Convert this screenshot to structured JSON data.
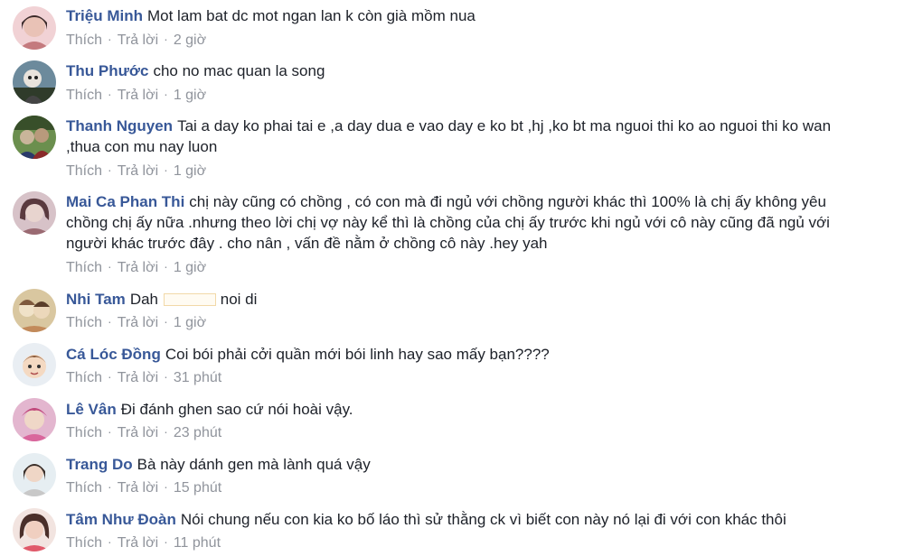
{
  "actions": {
    "like": "Thích",
    "reply": "Trả lời",
    "separator": "·"
  },
  "comments": [
    {
      "author": "Triệu Minh",
      "text": "Mot lam bat dc mot ngan lan k còn già mồm nua",
      "time": "2 giờ",
      "avatar_colors": [
        "#f1d2d5",
        "#c47a7e",
        "#3b2a2a"
      ]
    },
    {
      "author": "Thu Phước",
      "text": "cho no mac quan la song",
      "time": "1 giờ",
      "avatar_colors": [
        "#6c8a9c",
        "#2f3b2a",
        "#e9e3dc"
      ]
    },
    {
      "author": "Thanh Nguyen",
      "lines": [
        "Tai a day ko phai tai e ,a day dua e vao day e ko bt ,hj ,ko bt ma nguoi thi ko ao nguoi thi ko wan",
        ",thua con mu nay luon"
      ],
      "time": "1 giờ",
      "avatar_colors": [
        "#6b8f4e",
        "#384f2a",
        "#c9b59a"
      ]
    },
    {
      "author": "Mai Ca Phan Thi",
      "lines": [
        "chị này cũng có chồng , có con mà đi ngủ với chồng người khác thì 100% là chị ấy không yêu",
        "chồng chị ấy nữa .nhưng theo lời chị vợ này kể thì là chồng của chị ấy trước khi ngủ với cô này cũng đã ngủ với",
        "người khác trước đây . cho nân , vấn đề nằm ở chồng cô này .hey yah"
      ],
      "time": "1 giờ",
      "avatar_colors": [
        "#d7c2c8",
        "#5a3a3f",
        "#e8d4cf"
      ]
    },
    {
      "author": "Nhi Tam",
      "text_before": "Dah",
      "text_after": "noi di",
      "time": "1 giờ",
      "avatar_colors": [
        "#d9c7a0",
        "#7f5a3e",
        "#f0e2c8"
      ]
    },
    {
      "author": "Cá Lóc Đồng",
      "text": "Coi bói phải cởi quần mới bói linh hay sao mấy bạn????",
      "time": "31 phút",
      "avatar_colors": [
        "#e9eef3",
        "#f4d9c2",
        "#8a5a3a"
      ]
    },
    {
      "author": "Lê Vân",
      "text": "Đi đánh ghen sao cứ nói hoài vậy.",
      "time": "23 phút",
      "avatar_colors": [
        "#e3b6cf",
        "#c0477a",
        "#efd7c7"
      ]
    },
    {
      "author": "Trang Do",
      "text": "Bà này dánh gen mà lành quá vậy",
      "time": "15 phút",
      "avatar_colors": [
        "#e6eef2",
        "#3a2f2a",
        "#efd6c6"
      ]
    },
    {
      "author": "Tâm Như Đoàn",
      "text": "Nói chung nếu con kia ko bố láo thì sử thằng ck vì biết con này nó lại đi với con khác thôi",
      "time": "11 phút",
      "avatar_colors": [
        "#f2e4e0",
        "#4a2f2a",
        "#f0cfc0"
      ]
    }
  ]
}
